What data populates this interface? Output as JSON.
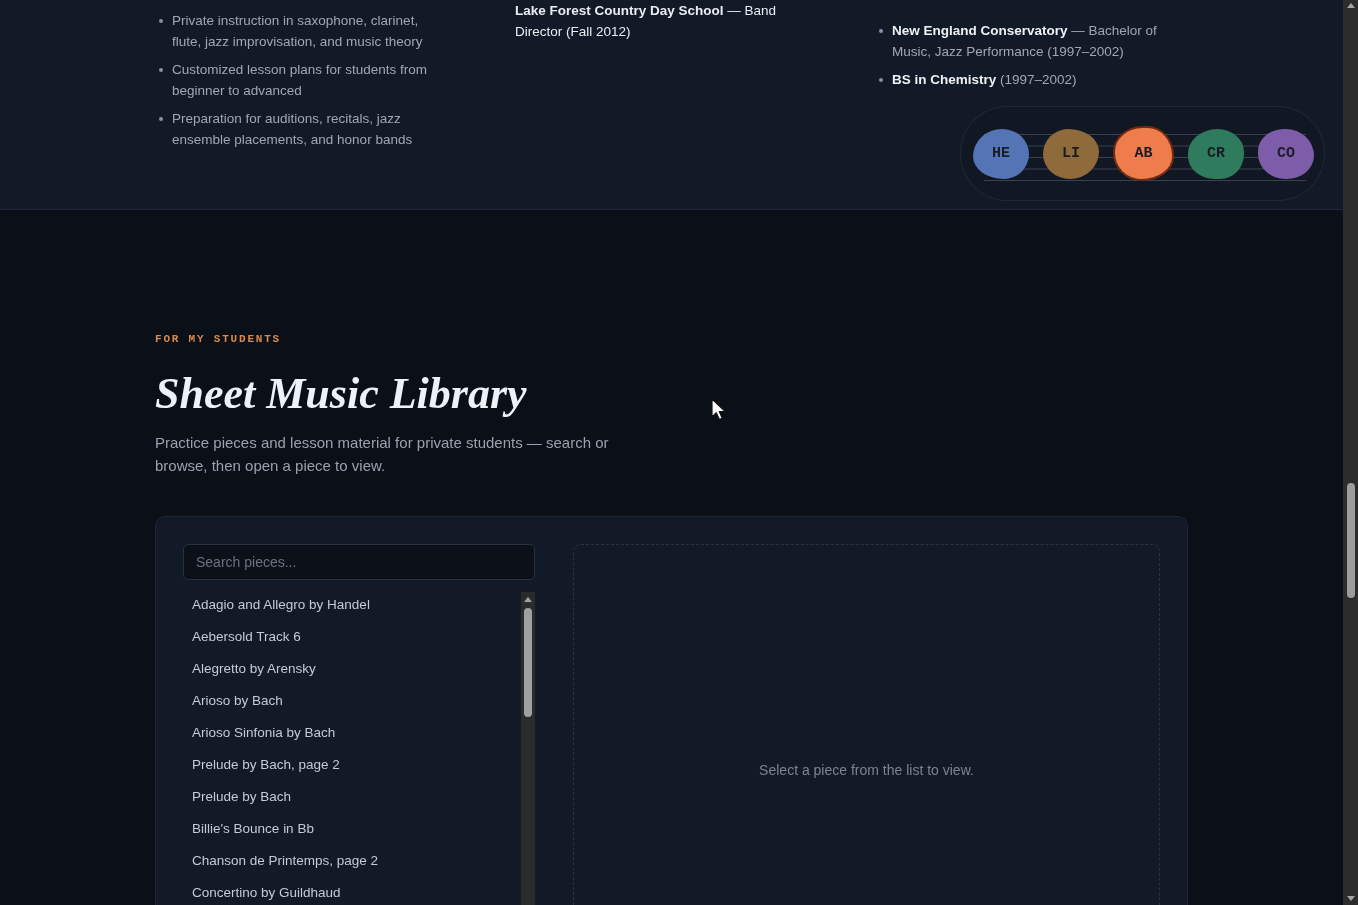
{
  "background_section": {
    "columns": [
      {
        "kind": "bullets",
        "items": [
          "Private instruction in saxophone, clarinet, flute, jazz improvisation, and music theory",
          "Customized lesson plans for students from beginner to advanced",
          "Preparation for auditions, recitals, jazz ensemble placements, and honor bands"
        ]
      },
      {
        "kind": "text",
        "text": "**Lake Forest Country Day School** — Band Director (Fall 2012)"
      },
      {
        "kind": "bullets",
        "items": [
          "**New England Conservatory** — Bachelor of Music, Jazz Performance (1997–2002)",
          "**BS in Chemistry** (1997–2002)"
        ]
      }
    ]
  },
  "nav": {
    "items": [
      {
        "label": "HE",
        "color": "#5574b5",
        "selected": false
      },
      {
        "label": "LI",
        "color": "#8f6b3b",
        "selected": false
      },
      {
        "label": "AB",
        "color": "#ef7d4b",
        "selected": true
      },
      {
        "label": "CR",
        "color": "#2f7b5e",
        "selected": false
      },
      {
        "label": "CO",
        "color": "#7d5ca9",
        "selected": false
      }
    ]
  },
  "library": {
    "eyebrow": "FOR MY STUDENTS",
    "title": "Sheet Music Library",
    "description": "Practice pieces and lesson material for private students — search or browse, then open a piece to view.",
    "search": {
      "placeholder": "Search pieces..."
    },
    "pieces": [
      {
        "title": "Adagio and Allegro by Handel",
        "selected": false
      },
      {
        "title": "Aebersold Track 6",
        "selected": false
      },
      {
        "title": "Alegretto by Arensky",
        "selected": false
      },
      {
        "title": "Arioso by Bach",
        "selected": false
      },
      {
        "title": "Arioso Sinfonia by Bach",
        "selected": false
      },
      {
        "title": "Prelude by Bach, page 2",
        "selected": false
      },
      {
        "title": "Prelude by Bach",
        "selected": false
      },
      {
        "title": "Billie's Bounce in Bb",
        "selected": false
      },
      {
        "title": "Chanson de Printemps, page 2",
        "selected": false
      },
      {
        "title": "Concertino by Guildhaud",
        "selected": false
      }
    ],
    "viewer": {
      "message": "Select a piece from the list to view."
    }
  }
}
